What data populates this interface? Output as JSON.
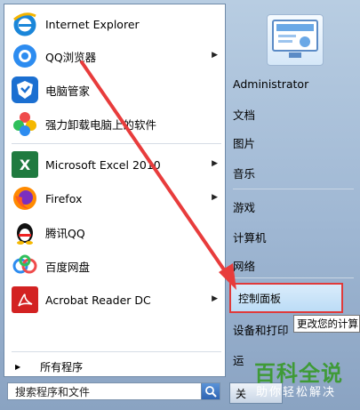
{
  "left_menu": {
    "items": [
      {
        "label": "Internet Explorer",
        "icon": "internet-explorer-icon",
        "has_arrow": false
      },
      {
        "label": "QQ浏览器",
        "icon": "qq-browser-icon",
        "has_arrow": true
      },
      {
        "label": "电脑管家",
        "icon": "pc-manager-icon",
        "has_arrow": false
      },
      {
        "label": "强力卸载电脑上的软件",
        "icon": "uninstaller-icon",
        "has_arrow": false
      },
      {
        "label": "Microsoft Excel 2010",
        "icon": "excel-icon",
        "has_arrow": true
      },
      {
        "label": "Firefox",
        "icon": "firefox-icon",
        "has_arrow": true
      },
      {
        "label": "腾讯QQ",
        "icon": "qq-penguin-icon",
        "has_arrow": false
      },
      {
        "label": "百度网盘",
        "icon": "baidu-netdisk-icon",
        "has_arrow": false
      },
      {
        "label": "Acrobat Reader DC",
        "icon": "acrobat-icon",
        "has_arrow": true
      }
    ],
    "all_programs": "所有程序",
    "search_placeholder": "搜索程序和文件"
  },
  "right_menu": {
    "user": "Administrator",
    "items": [
      "文档",
      "图片",
      "音乐",
      "游戏",
      "计算机",
      "网络",
      "控制面板",
      "设备和打印",
      "运"
    ],
    "highlighted": "控制面板",
    "tooltip": "更改您的计算",
    "shutdown_label": "关"
  },
  "watermark": {
    "title": "百科全说",
    "subtitle": "助你轻松解决"
  },
  "colors": {
    "highlight_border": "#e03a3a",
    "arrow": "#e83c3c",
    "watermark_green": "#3f9a37"
  }
}
